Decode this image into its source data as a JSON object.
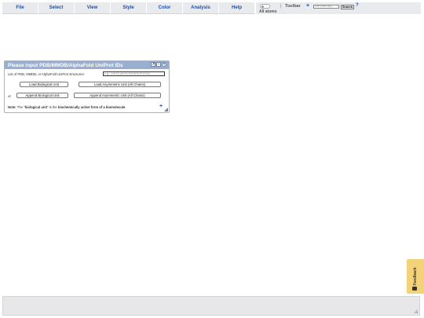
{
  "menubar": {
    "items": [
      {
        "label": "File"
      },
      {
        "label": "Select"
      },
      {
        "label": "View"
      },
      {
        "label": "Style"
      },
      {
        "label": "Color"
      },
      {
        "label": "Analysis"
      },
      {
        "label": "Help"
      }
    ]
  },
  "toolbar": {
    "toggle_label": "All atoms",
    "separator": "|",
    "label": "Toolbar",
    "plus": "+",
    "search_placeholder": "one-letter seq.",
    "search_button": "Search",
    "help": "?"
  },
  "dialog": {
    "title": "Please input PDB/MMDB/AlphaFold UniProt IDs",
    "list_label": "List of PDB, MMDB, or AlphaFold UniProt structures:",
    "input_placeholder": "e.g., 1HHO,4N7N,P69905,P01942",
    "buttons": {
      "load_biological": "Load Biological Unit",
      "load_asymmetric": "Load Asymmetric Unit (All Chains)",
      "append_biological": "Append Biological Unit",
      "append_asymmetric": "Append Asymmetric Unit (All Chains)"
    },
    "or_label": "or",
    "note_prefix": "Note:",
    "note_text_1": "The \"",
    "note_bold": "biological unit",
    "note_text_2": "\" is the ",
    "note_bold_2": "biochemically active form of a biomolecule",
    "note_text_3": ".",
    "plus": "+"
  },
  "feedback": {
    "label": "Feedback"
  },
  "colors": {
    "menu_bg": "#e8eaee",
    "menu_text": "#1f4e9e",
    "dialog_header": "#9aaed0",
    "feedback_bg": "#f3d27a",
    "command_bg": "#e7e7e9"
  }
}
